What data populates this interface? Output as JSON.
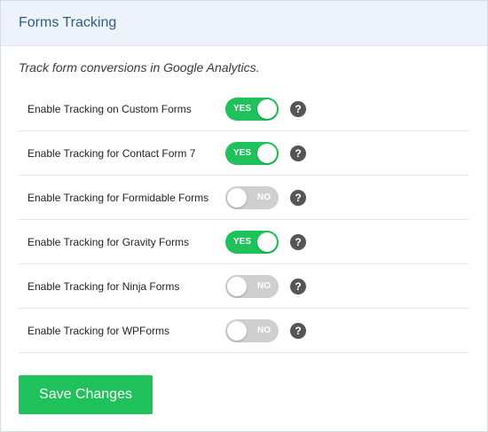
{
  "header": {
    "title": "Forms Tracking"
  },
  "description": "Track form conversions in Google Analytics.",
  "settings": [
    {
      "label": "Enable Tracking on Custom Forms",
      "state": "YES"
    },
    {
      "label": "Enable Tracking for Contact Form 7",
      "state": "YES"
    },
    {
      "label": "Enable Tracking for Formidable Forms",
      "state": "NO"
    },
    {
      "label": "Enable Tracking for Gravity Forms",
      "state": "YES"
    },
    {
      "label": "Enable Tracking for Ninja Forms",
      "state": "NO"
    },
    {
      "label": "Enable Tracking for WPForms",
      "state": "NO"
    }
  ],
  "help_icon": "?",
  "save_button_label": "Save Changes",
  "colors": {
    "accent": "#1fc25a",
    "toggle_off": "#cfcfcf",
    "header_bg": "#eef3fb",
    "title": "#2f5d8a"
  }
}
